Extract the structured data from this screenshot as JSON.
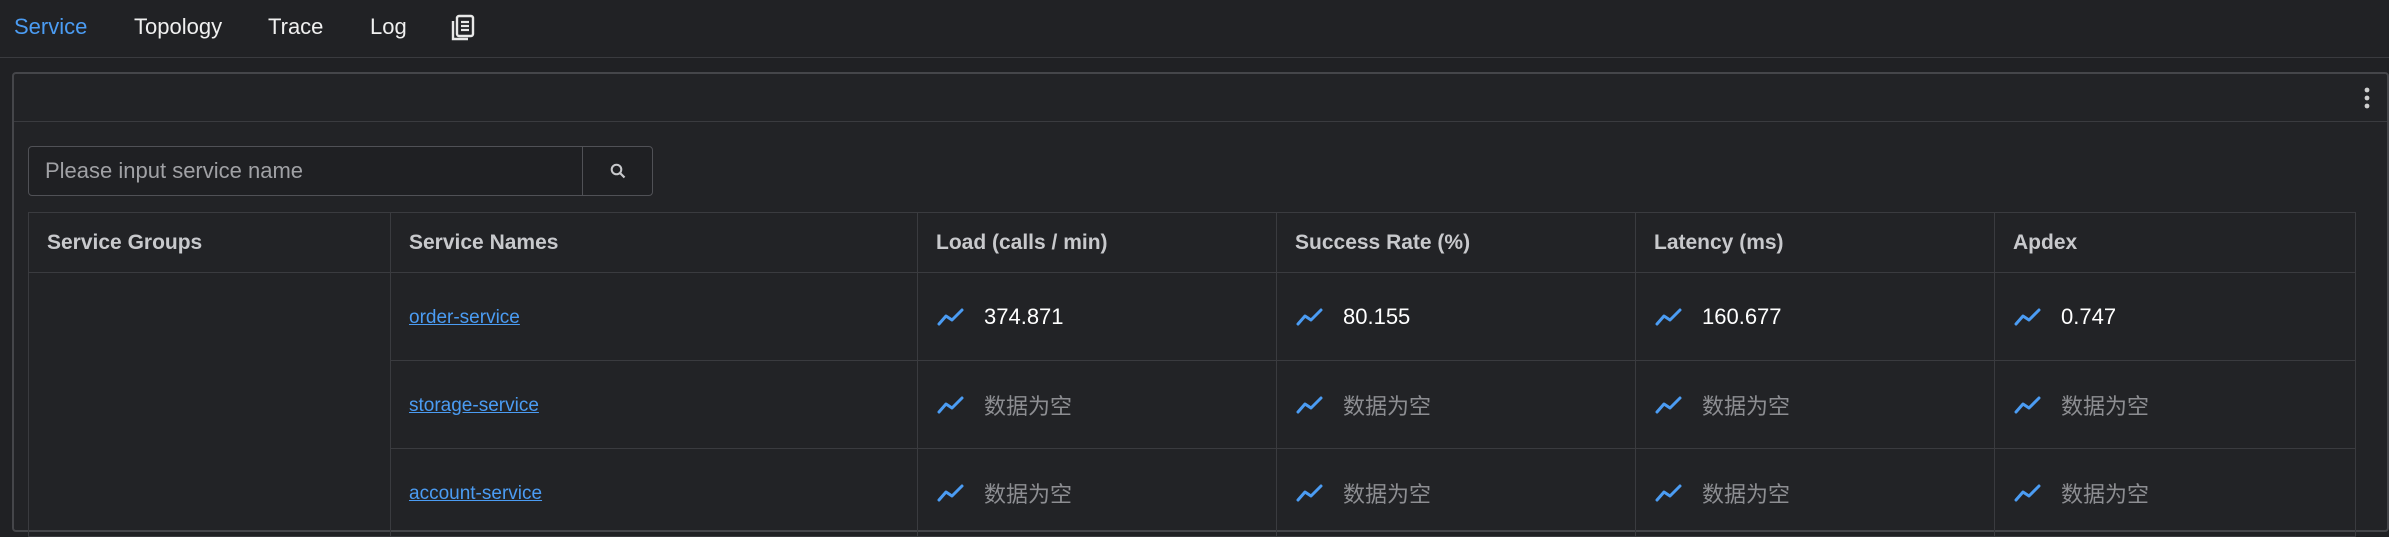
{
  "nav": {
    "tabs": [
      {
        "label": "Service",
        "active": true
      },
      {
        "label": "Topology",
        "active": false
      },
      {
        "label": "Trace",
        "active": false
      },
      {
        "label": "Log",
        "active": false
      }
    ],
    "extra_icon": "document-icon"
  },
  "search": {
    "placeholder": "Please input service name",
    "value": "",
    "button_icon": "search-icon"
  },
  "table": {
    "headers": [
      "Service Groups",
      "Service Names",
      "Load (calls / min)",
      "Success Rate (%)",
      "Latency (ms)",
      "Apdex"
    ],
    "rows": [
      {
        "group": "",
        "name": "order-service",
        "load": "374.871",
        "success": "80.155",
        "latency": "160.677",
        "apdex": "0.747"
      },
      {
        "group": "",
        "name": "storage-service",
        "load": "数据为空",
        "success": "数据为空",
        "latency": "数据为空",
        "apdex": "数据为空"
      },
      {
        "group": "",
        "name": "account-service",
        "load": "数据为空",
        "success": "数据为空",
        "latency": "数据为空",
        "apdex": "数据为空"
      }
    ]
  },
  "colors": {
    "accent": "#4b9cf3",
    "background": "#202124",
    "empty_text": "#8d8e92"
  }
}
